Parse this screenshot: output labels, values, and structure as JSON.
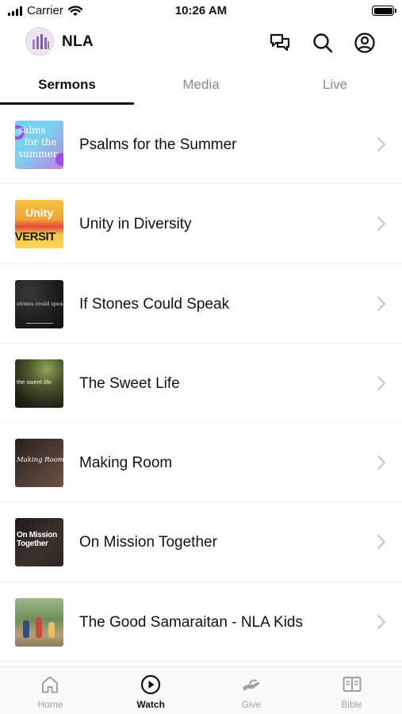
{
  "status": {
    "carrier": "Carrier",
    "time": "10:26 AM"
  },
  "header": {
    "title": "NLA"
  },
  "tabs": [
    {
      "label": "Sermons",
      "active": true
    },
    {
      "label": "Media",
      "active": false
    },
    {
      "label": "Live",
      "active": false
    }
  ],
  "sermons": [
    {
      "title": "Psalms for the Summer",
      "thumb_text": "Psalms for the summer"
    },
    {
      "title": "Unity in Diversity",
      "thumb_text": "Unity DIVERSIT"
    },
    {
      "title": "If Stones Could Speak",
      "thumb_text": "if stones could speak"
    },
    {
      "title": "The Sweet Life",
      "thumb_text": "the sweet life"
    },
    {
      "title": "Making Room",
      "thumb_text": "Making Room"
    },
    {
      "title": "On Mission Together",
      "thumb_text": "On Mission Together"
    },
    {
      "title": "The Good Samaraitan - NLA Kids",
      "thumb_text": ""
    }
  ],
  "tabbar": [
    {
      "label": "Home",
      "icon": "home-icon",
      "active": false
    },
    {
      "label": "Watch",
      "icon": "play-circle-icon",
      "active": true
    },
    {
      "label": "Give",
      "icon": "give-icon",
      "active": false
    },
    {
      "label": "Bible",
      "icon": "bible-icon",
      "active": false
    }
  ]
}
